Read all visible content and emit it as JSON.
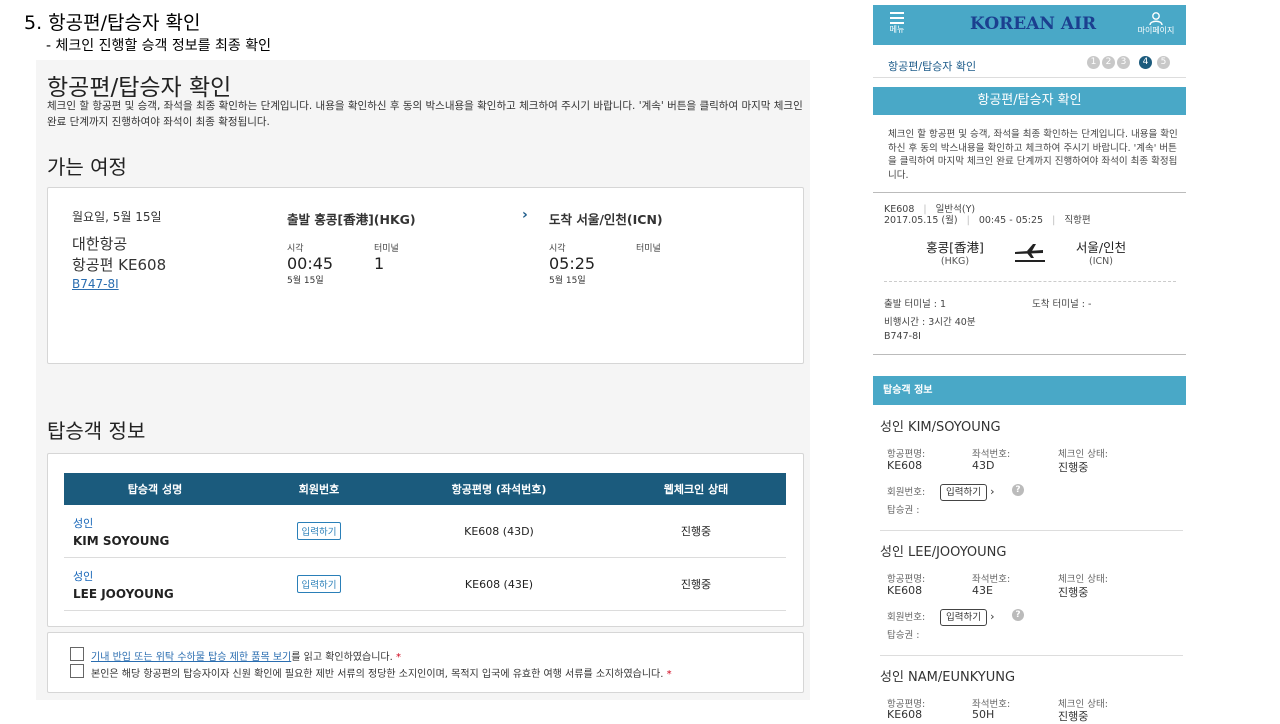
{
  "slide": {
    "title": "5. 항공편/탑승자 확인",
    "subtitle": "- 체크인 진행할 승객 정보를 최종 확인"
  },
  "left": {
    "page_title": "항공편/탑승자 확인",
    "description": "체크인 할 항공편 및 승객, 좌석을 최종 확인하는 단계입니다. 내용을 확인하신 후 동의 박스내용을 확인하고 체크하여 주시기 바랍니다. '계속' 버튼을 클릭하여 마지막 체크인 완료 단계까지 진행하여야 좌석이 최종 확정됩니다.",
    "trip_heading": "가는 여정",
    "trip": {
      "date": "월요일, 5월 15일",
      "airline": "대한항공",
      "flight": "항공편 KE608",
      "aircraft": "B747-8I",
      "departure_title": "출발 홍콩[香港](HKG)",
      "arrival_title": "도착 서울/인천(ICN)",
      "time_label": "시각",
      "terminal_label": "터미널",
      "dep_time": "00:45",
      "dep_terminal": "1",
      "dep_date": "5월 15일",
      "arr_time": "05:25",
      "arr_date": "5월 15일",
      "chevron": "›"
    },
    "pax_heading": "탑승객 정보",
    "pax_table": {
      "headers": [
        "탑승객 성명",
        "회원번호",
        "항공편명 (좌석번호)",
        "웹체크인 상태"
      ],
      "rows": [
        {
          "type": "성인",
          "name": "KIM SOYOUNG",
          "button": "입력하기",
          "flight": "KE608 (43D)",
          "status": "진행중"
        },
        {
          "type": "성인",
          "name": "LEE JOOYOUNG",
          "button": "입력하기",
          "flight": "KE608 (43E)",
          "status": "진행중"
        }
      ]
    },
    "agreements": {
      "item1_link": "기내 반입 또는 위탁 수하물 탑승 제한 품목 보기",
      "item1_rest": "를 읽고 확인하였습니다.",
      "item2": "본인은 해당 항공편의 탑승자이자 신원 확인에 필요한 제반 서류의 정당한 소지인이며, 목적지 입국에 유효한 여행 서류를 소지하였습니다.",
      "required_mark": "*"
    }
  },
  "mobile": {
    "menu_label": "메뉴",
    "logo": "KOREAN AIR",
    "mypage_label": "마이페이지",
    "step_title": "항공편/탑승자 확인",
    "steps": [
      "1",
      "2",
      "3",
      "4",
      "5"
    ],
    "band_title": "항공편/탑승자 확인",
    "description": "체크인 할 항공편 및 승객, 좌석을 최종 확인하는 단계입니다. 내용을 확인하신 후 동의 박스내용을 확인하고 체크하여 주시기 바랍니다. '계속' 버튼을 클릭하여 마지막 체크인 완료 단계까지 진행하여야 좌석이 최종 확정됩니다.",
    "flight_no": "KE608",
    "cabin": "일반석(Y)",
    "date": "2017.05.15 (월)",
    "time_range": "00:45 - 05:25",
    "route_type": "직항편",
    "sep": "|",
    "from_city": "홍콩[香港]",
    "from_code": "(HKG)",
    "to_city": "서울/인천",
    "to_code": "(ICN)",
    "dep_terminal": "출발 터미널 : 1",
    "arr_terminal": "도착 터미널 : -",
    "duration": "비행시간 : 3시간 40분",
    "aircraft": "B747-8I",
    "pax_band": "탑승객 정보",
    "labels": {
      "flight": "항공편명:",
      "seat": "좌석번호:",
      "status": "체크인 상태:",
      "member": "회원번호:",
      "ticket": "탑승권 :"
    },
    "input_button": "입력하기",
    "help": "?",
    "passengers": [
      {
        "name": "성인 KIM/SOYOUNG",
        "flight": "KE608",
        "seat": "43D",
        "status": "진행중"
      },
      {
        "name": "성인 LEE/JOOYOUNG",
        "flight": "KE608",
        "seat": "43E",
        "status": "진행중"
      },
      {
        "name": "성인 NAM/EUNKYUNG",
        "flight": "KE608",
        "seat": "50H",
        "status": "진행중"
      }
    ]
  }
}
